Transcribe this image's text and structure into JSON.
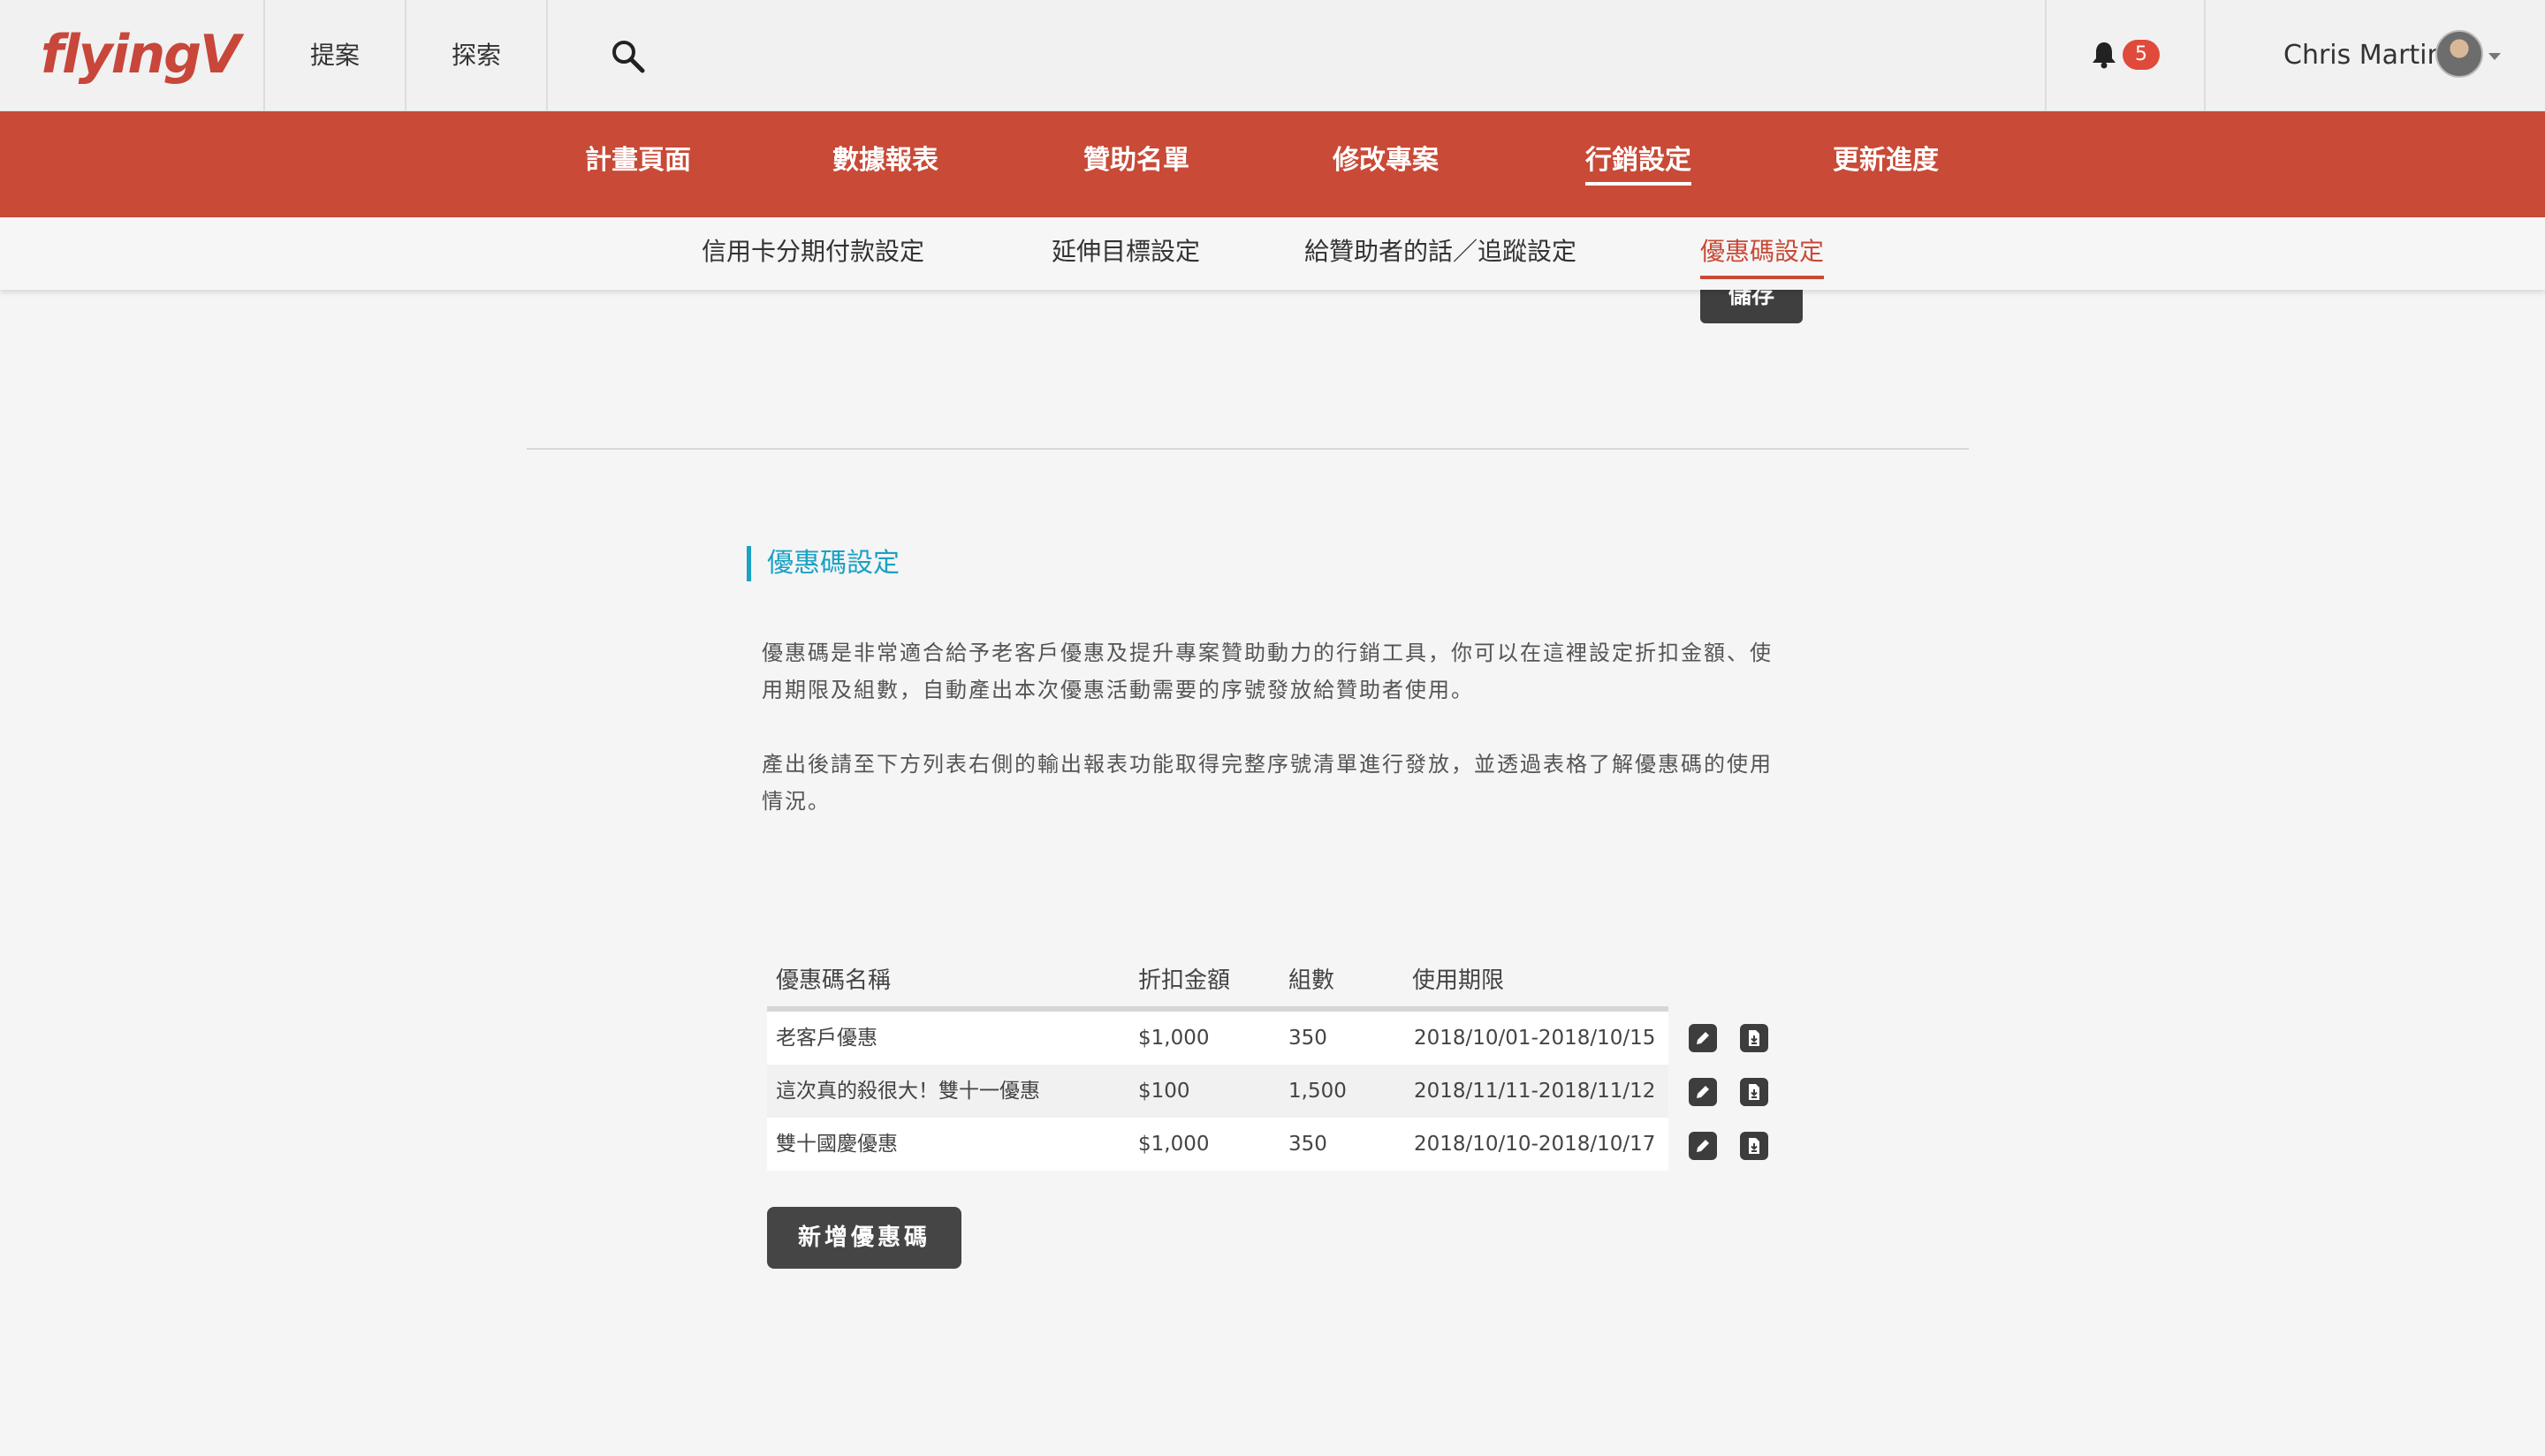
{
  "header": {
    "logo_text": "flyingV",
    "nav": [
      "提案",
      "探索"
    ],
    "notification_count": "5",
    "user_name": "Chris Martin"
  },
  "main_nav": {
    "items": [
      "計畫頁面",
      "數據報表",
      "贊助名單",
      "修改專案",
      "行銷設定",
      "更新進度"
    ],
    "active": "行銷設定"
  },
  "sub_nav": {
    "items": [
      "信用卡分期付款設定",
      "延伸目標設定",
      "給贊助者的話／追蹤設定",
      "優惠碼設定"
    ],
    "active": "優惠碼設定"
  },
  "save_button_label": "儲存",
  "coupon_section": {
    "title": "優惠碼設定",
    "description_lines_1": [
      "優惠碼是非常適合給予老客戶優惠及提升專案贊助動力的行銷工具，你可以在這裡設定折扣金額、使",
      "用期限及組數，自動產出本次優惠活動需要的序號發放給贊助者使用。"
    ],
    "description_lines_2": [
      "產出後請至下方列表右側的輸出報表功能取得完整序號清單進行發放，並透過表格了解優惠碼的使用",
      "情況。"
    ]
  },
  "coupon_table": {
    "headers": [
      "優惠碼名稱",
      "折扣金額",
      "組數",
      "使用期限"
    ],
    "rows": [
      {
        "name": "老客戶優惠",
        "amount": "$1,000",
        "count": "350",
        "period": "2018/10/01-2018/10/15"
      },
      {
        "name": "這次真的殺很大！雙十一優惠",
        "amount": "$100",
        "count": "1,500",
        "period": "2018/11/11-2018/11/12"
      },
      {
        "name": "雙十國慶優惠",
        "amount": "$1,000",
        "count": "350",
        "period": "2018/10/10-2018/10/17"
      }
    ]
  },
  "add_coupon_label": "新增優惠碼",
  "colors": {
    "brand_red": "#c84a37",
    "accent_cyan": "#1aa1c4",
    "badge_red": "#e04a3a",
    "dark_button": "#454545"
  },
  "icons": {
    "search": "search-icon",
    "bell": "bell-icon",
    "edit": "pencil-icon",
    "export": "download-file-icon"
  }
}
